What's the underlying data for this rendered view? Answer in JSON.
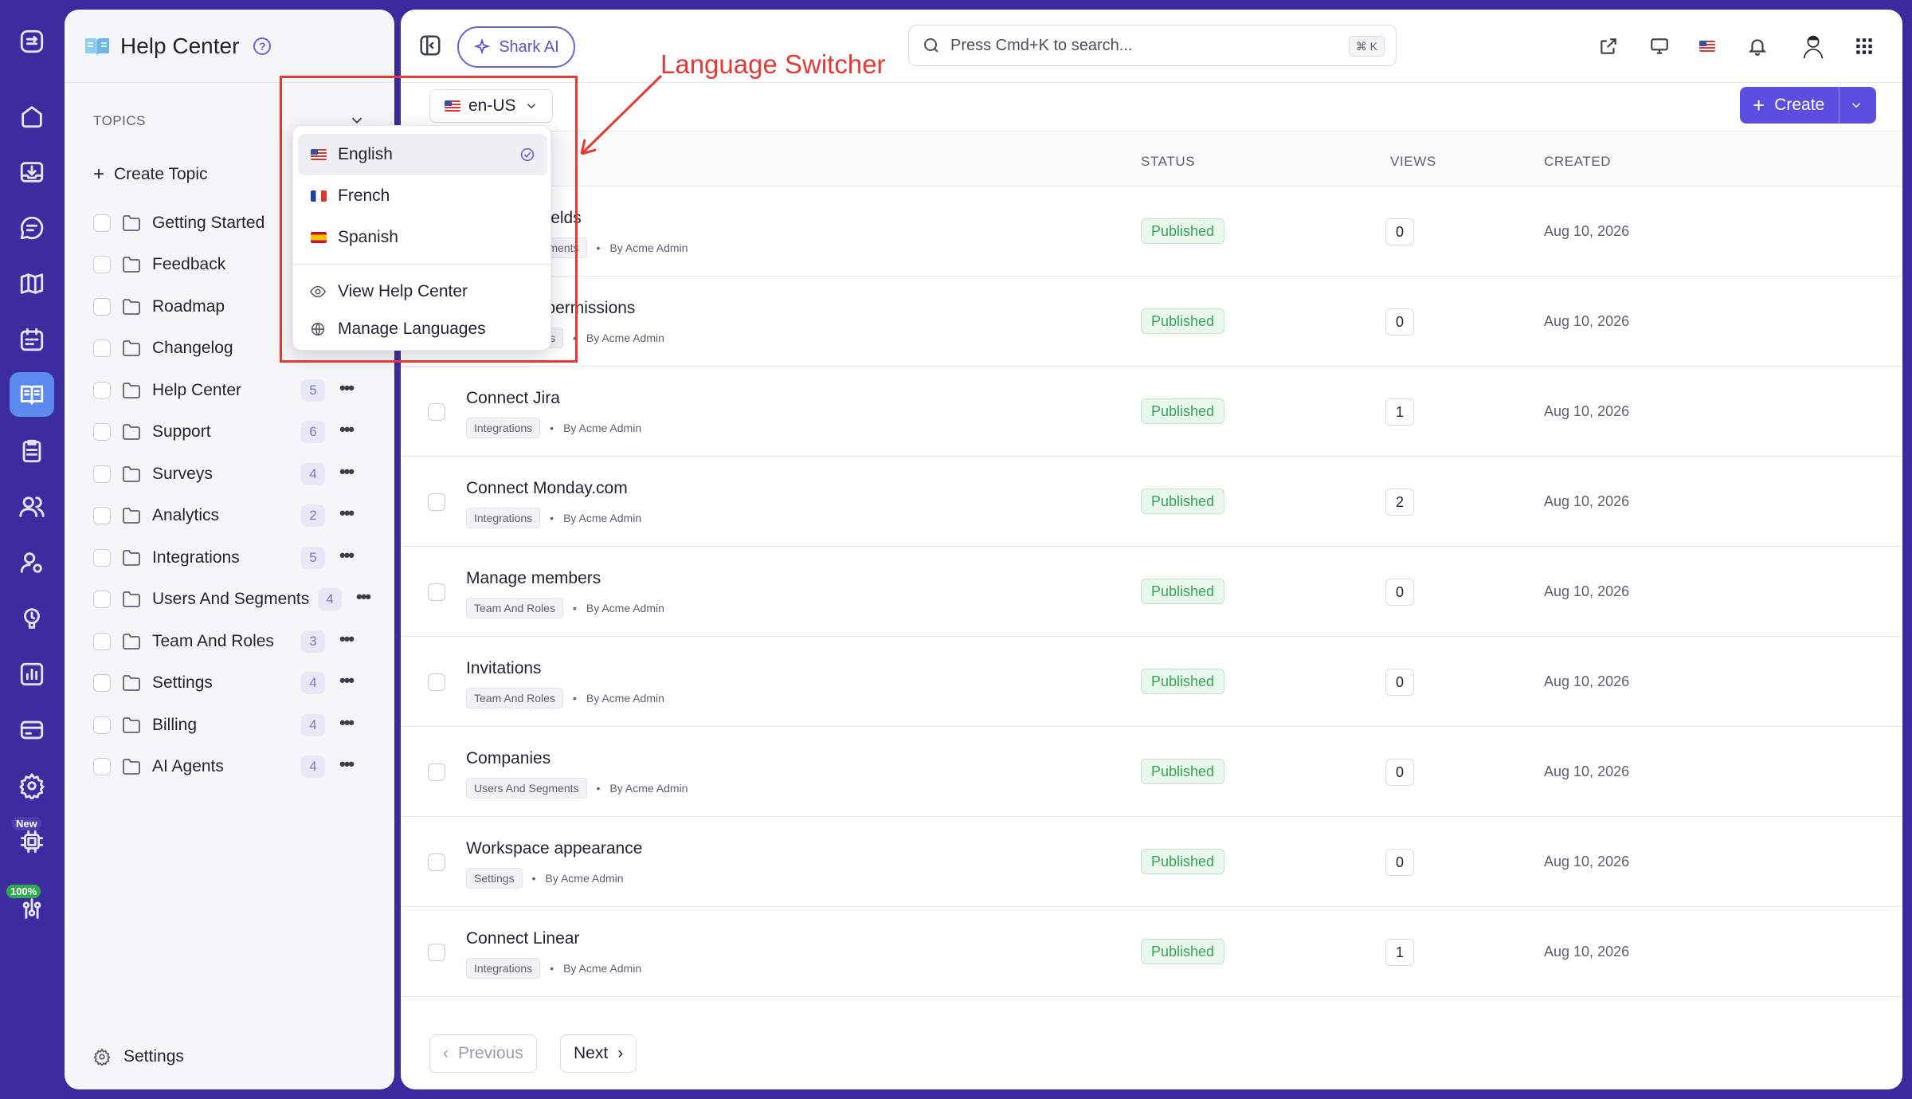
{
  "rail": {
    "badge_new": "New",
    "badge_percent": "100%"
  },
  "topics_panel": {
    "title": "Help Center",
    "help_glyph": "?",
    "section_label": "TOPICS",
    "create_label": "Create Topic",
    "items": [
      {
        "label": "Getting Started",
        "count": ""
      },
      {
        "label": "Feedback",
        "count": ""
      },
      {
        "label": "Roadmap",
        "count": ""
      },
      {
        "label": "Changelog",
        "count": ""
      },
      {
        "label": "Help Center",
        "count": "5"
      },
      {
        "label": "Support",
        "count": "6"
      },
      {
        "label": "Surveys",
        "count": "4"
      },
      {
        "label": "Analytics",
        "count": "2"
      },
      {
        "label": "Integrations",
        "count": "5"
      },
      {
        "label": "Users And Segments",
        "count": "4"
      },
      {
        "label": "Team And Roles",
        "count": "3"
      },
      {
        "label": "Settings",
        "count": "4"
      },
      {
        "label": "Billing",
        "count": "4"
      },
      {
        "label": "AI Agents",
        "count": "4"
      }
    ],
    "more_glyph": "•••",
    "settings_label": "Settings"
  },
  "topbar": {
    "shark_ai_label": "Shark AI",
    "search_placeholder": "Press Cmd+K to search...",
    "search_shortcut": "⌘ K"
  },
  "toolbar": {
    "locale": "en-US",
    "create_label": "Create"
  },
  "table": {
    "headers": {
      "status": "STATUS",
      "views": "VIEWS",
      "created": "CREATED"
    },
    "rows": [
      {
        "title": "Company fields",
        "tag": "Users And Segments",
        "author": "By Acme Admin",
        "status": "Published",
        "views": "0",
        "created": "Aug 10, 2026"
      },
      {
        "title": "Roles and permissions",
        "tag": "Team And Roles",
        "author": "By Acme Admin",
        "status": "Published",
        "views": "0",
        "created": "Aug 10, 2026"
      },
      {
        "title": "Connect Jira",
        "tag": "Integrations",
        "author": "By Acme Admin",
        "status": "Published",
        "views": "1",
        "created": "Aug 10, 2026"
      },
      {
        "title": "Connect Monday.com",
        "tag": "Integrations",
        "author": "By Acme Admin",
        "status": "Published",
        "views": "2",
        "created": "Aug 10, 2026"
      },
      {
        "title": "Manage members",
        "tag": "Team And Roles",
        "author": "By Acme Admin",
        "status": "Published",
        "views": "0",
        "created": "Aug 10, 2026"
      },
      {
        "title": "Invitations",
        "tag": "Team And Roles",
        "author": "By Acme Admin",
        "status": "Published",
        "views": "0",
        "created": "Aug 10, 2026"
      },
      {
        "title": "Companies",
        "tag": "Users And Segments",
        "author": "By Acme Admin",
        "status": "Published",
        "views": "0",
        "created": "Aug 10, 2026"
      },
      {
        "title": "Workspace appearance",
        "tag": "Settings",
        "author": "By Acme Admin",
        "status": "Published",
        "views": "0",
        "created": "Aug 10, 2026"
      },
      {
        "title": "Connect Linear",
        "tag": "Integrations",
        "author": "By Acme Admin",
        "status": "Published",
        "views": "1",
        "created": "Aug 10, 2026"
      }
    ],
    "dot": "•"
  },
  "pagination": {
    "previous": "Previous",
    "next": "Next"
  },
  "language_menu": {
    "languages": [
      {
        "label": "English",
        "flag": "us"
      },
      {
        "label": "French",
        "flag": "fr"
      },
      {
        "label": "Spanish",
        "flag": "es"
      }
    ],
    "view_help_center": "View Help Center",
    "manage_languages": "Manage Languages"
  },
  "annotation": {
    "label": "Language Switcher",
    "color": "#e53935"
  },
  "colors": {
    "rail": "#3c2c9f",
    "accent": "#5b4ee0",
    "active_rail": "#5a8af0",
    "published_green": "#35a55a"
  }
}
